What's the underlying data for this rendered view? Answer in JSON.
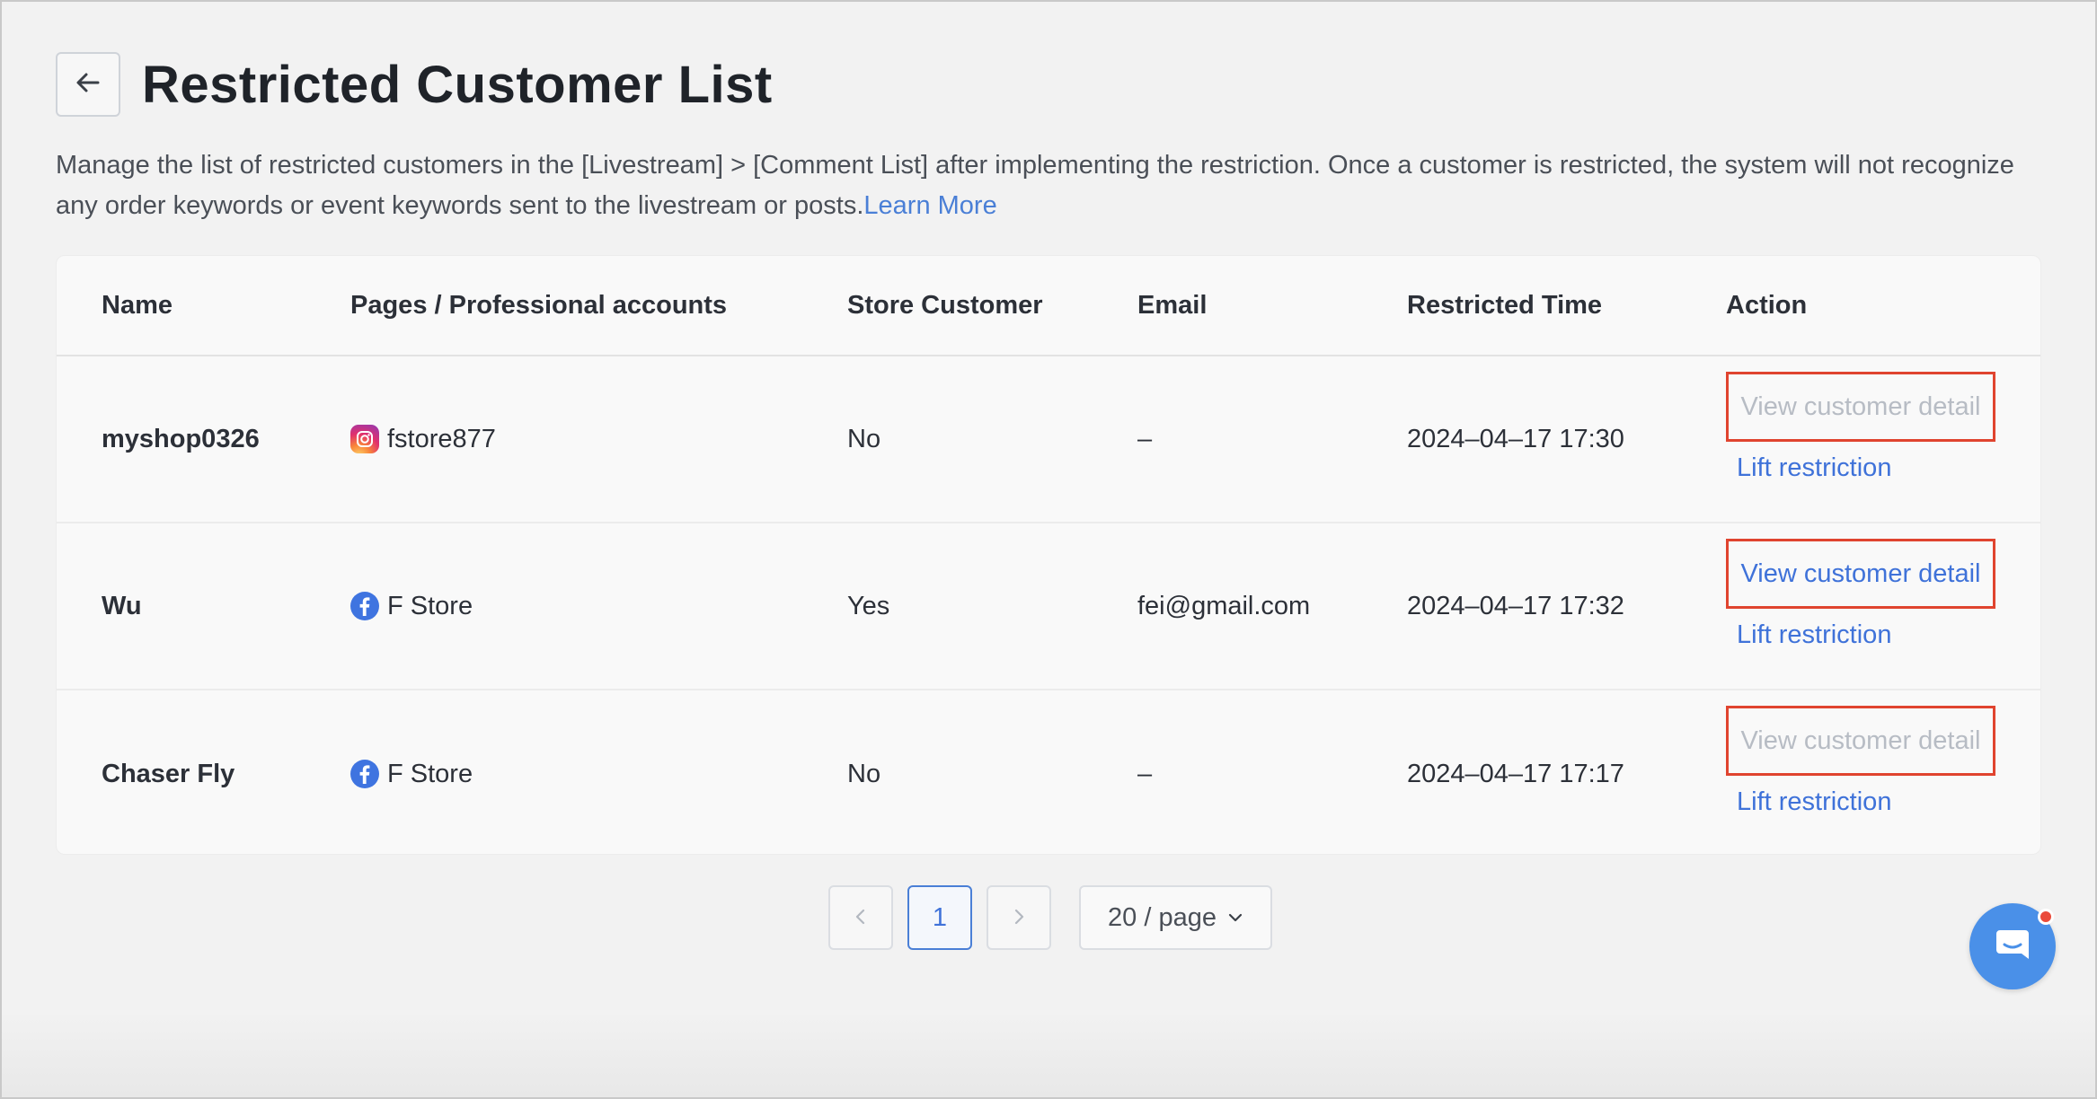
{
  "header": {
    "title": "Restricted Customer List",
    "back_icon": "arrow-left-icon"
  },
  "description": {
    "text": "Manage the list of restricted customers in the [Livestream] > [Comment List] after implementing the restriction. Once a customer is restricted, the system will not recognize any order keywords or event keywords sent to the livestream or posts.",
    "link": "Learn More"
  },
  "table": {
    "columns": [
      "Name",
      "Pages / Professional accounts",
      "Store Customer",
      "Email",
      "Restricted Time",
      "Action"
    ],
    "rows": [
      {
        "name": "myshop0326",
        "page_icon": "instagram-icon",
        "page": "fstore877",
        "store_customer": "No",
        "email": "–",
        "restricted_time": "2024–04–17 17:30",
        "view_detail": "View customer detail",
        "view_detail_enabled": false,
        "lift": "Lift restriction"
      },
      {
        "name": "Wu",
        "page_icon": "facebook-icon",
        "page": "F Store",
        "store_customer": "Yes",
        "email": "fei@gmail.com",
        "restricted_time": "2024–04–17 17:32",
        "view_detail": "View customer detail",
        "view_detail_enabled": true,
        "lift": "Lift restriction"
      },
      {
        "name": "Chaser Fly",
        "page_icon": "facebook-icon",
        "page": "F Store",
        "store_customer": "No",
        "email": "–",
        "restricted_time": "2024–04–17 17:17",
        "view_detail": "View customer detail",
        "view_detail_enabled": false,
        "lift": "Lift restriction"
      }
    ]
  },
  "pagination": {
    "current_page": "1",
    "page_size": "20 / page"
  },
  "colors": {
    "accent": "#3f72d9",
    "highlight_border": "#e0442f",
    "disabled_text": "#b7bcc4",
    "chat_launcher": "#4a90e8"
  },
  "chat": {
    "icon": "chat-bubble-icon"
  }
}
